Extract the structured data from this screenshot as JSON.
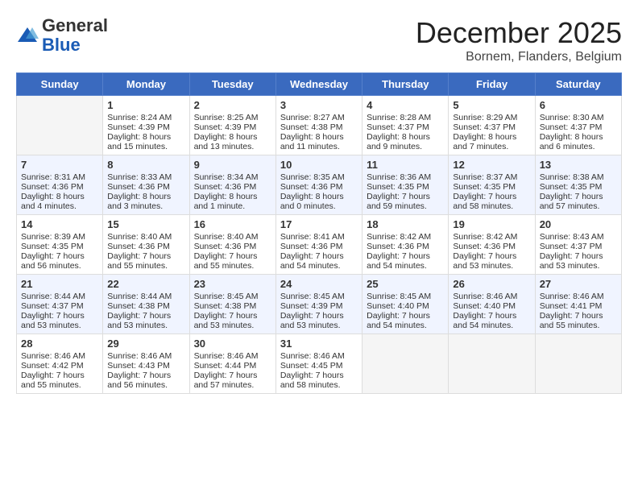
{
  "header": {
    "logo_general": "General",
    "logo_blue": "Blue",
    "month_title": "December 2025",
    "subtitle": "Bornem, Flanders, Belgium"
  },
  "days_of_week": [
    "Sunday",
    "Monday",
    "Tuesday",
    "Wednesday",
    "Thursday",
    "Friday",
    "Saturday"
  ],
  "weeks": [
    [
      {
        "day": "",
        "sunrise": "",
        "sunset": "",
        "daylight": "",
        "empty": true
      },
      {
        "day": "1",
        "sunrise": "Sunrise: 8:24 AM",
        "sunset": "Sunset: 4:39 PM",
        "daylight": "Daylight: 8 hours and 15 minutes."
      },
      {
        "day": "2",
        "sunrise": "Sunrise: 8:25 AM",
        "sunset": "Sunset: 4:39 PM",
        "daylight": "Daylight: 8 hours and 13 minutes."
      },
      {
        "day": "3",
        "sunrise": "Sunrise: 8:27 AM",
        "sunset": "Sunset: 4:38 PM",
        "daylight": "Daylight: 8 hours and 11 minutes."
      },
      {
        "day": "4",
        "sunrise": "Sunrise: 8:28 AM",
        "sunset": "Sunset: 4:37 PM",
        "daylight": "Daylight: 8 hours and 9 minutes."
      },
      {
        "day": "5",
        "sunrise": "Sunrise: 8:29 AM",
        "sunset": "Sunset: 4:37 PM",
        "daylight": "Daylight: 8 hours and 7 minutes."
      },
      {
        "day": "6",
        "sunrise": "Sunrise: 8:30 AM",
        "sunset": "Sunset: 4:37 PM",
        "daylight": "Daylight: 8 hours and 6 minutes."
      }
    ],
    [
      {
        "day": "7",
        "sunrise": "Sunrise: 8:31 AM",
        "sunset": "Sunset: 4:36 PM",
        "daylight": "Daylight: 8 hours and 4 minutes."
      },
      {
        "day": "8",
        "sunrise": "Sunrise: 8:33 AM",
        "sunset": "Sunset: 4:36 PM",
        "daylight": "Daylight: 8 hours and 3 minutes."
      },
      {
        "day": "9",
        "sunrise": "Sunrise: 8:34 AM",
        "sunset": "Sunset: 4:36 PM",
        "daylight": "Daylight: 8 hours and 1 minute."
      },
      {
        "day": "10",
        "sunrise": "Sunrise: 8:35 AM",
        "sunset": "Sunset: 4:36 PM",
        "daylight": "Daylight: 8 hours and 0 minutes."
      },
      {
        "day": "11",
        "sunrise": "Sunrise: 8:36 AM",
        "sunset": "Sunset: 4:35 PM",
        "daylight": "Daylight: 7 hours and 59 minutes."
      },
      {
        "day": "12",
        "sunrise": "Sunrise: 8:37 AM",
        "sunset": "Sunset: 4:35 PM",
        "daylight": "Daylight: 7 hours and 58 minutes."
      },
      {
        "day": "13",
        "sunrise": "Sunrise: 8:38 AM",
        "sunset": "Sunset: 4:35 PM",
        "daylight": "Daylight: 7 hours and 57 minutes."
      }
    ],
    [
      {
        "day": "14",
        "sunrise": "Sunrise: 8:39 AM",
        "sunset": "Sunset: 4:35 PM",
        "daylight": "Daylight: 7 hours and 56 minutes."
      },
      {
        "day": "15",
        "sunrise": "Sunrise: 8:40 AM",
        "sunset": "Sunset: 4:36 PM",
        "daylight": "Daylight: 7 hours and 55 minutes."
      },
      {
        "day": "16",
        "sunrise": "Sunrise: 8:40 AM",
        "sunset": "Sunset: 4:36 PM",
        "daylight": "Daylight: 7 hours and 55 minutes."
      },
      {
        "day": "17",
        "sunrise": "Sunrise: 8:41 AM",
        "sunset": "Sunset: 4:36 PM",
        "daylight": "Daylight: 7 hours and 54 minutes."
      },
      {
        "day": "18",
        "sunrise": "Sunrise: 8:42 AM",
        "sunset": "Sunset: 4:36 PM",
        "daylight": "Daylight: 7 hours and 54 minutes."
      },
      {
        "day": "19",
        "sunrise": "Sunrise: 8:42 AM",
        "sunset": "Sunset: 4:36 PM",
        "daylight": "Daylight: 7 hours and 53 minutes."
      },
      {
        "day": "20",
        "sunrise": "Sunrise: 8:43 AM",
        "sunset": "Sunset: 4:37 PM",
        "daylight": "Daylight: 7 hours and 53 minutes."
      }
    ],
    [
      {
        "day": "21",
        "sunrise": "Sunrise: 8:44 AM",
        "sunset": "Sunset: 4:37 PM",
        "daylight": "Daylight: 7 hours and 53 minutes."
      },
      {
        "day": "22",
        "sunrise": "Sunrise: 8:44 AM",
        "sunset": "Sunset: 4:38 PM",
        "daylight": "Daylight: 7 hours and 53 minutes."
      },
      {
        "day": "23",
        "sunrise": "Sunrise: 8:45 AM",
        "sunset": "Sunset: 4:38 PM",
        "daylight": "Daylight: 7 hours and 53 minutes."
      },
      {
        "day": "24",
        "sunrise": "Sunrise: 8:45 AM",
        "sunset": "Sunset: 4:39 PM",
        "daylight": "Daylight: 7 hours and 53 minutes."
      },
      {
        "day": "25",
        "sunrise": "Sunrise: 8:45 AM",
        "sunset": "Sunset: 4:40 PM",
        "daylight": "Daylight: 7 hours and 54 minutes."
      },
      {
        "day": "26",
        "sunrise": "Sunrise: 8:46 AM",
        "sunset": "Sunset: 4:40 PM",
        "daylight": "Daylight: 7 hours and 54 minutes."
      },
      {
        "day": "27",
        "sunrise": "Sunrise: 8:46 AM",
        "sunset": "Sunset: 4:41 PM",
        "daylight": "Daylight: 7 hours and 55 minutes."
      }
    ],
    [
      {
        "day": "28",
        "sunrise": "Sunrise: 8:46 AM",
        "sunset": "Sunset: 4:42 PM",
        "daylight": "Daylight: 7 hours and 55 minutes."
      },
      {
        "day": "29",
        "sunrise": "Sunrise: 8:46 AM",
        "sunset": "Sunset: 4:43 PM",
        "daylight": "Daylight: 7 hours and 56 minutes."
      },
      {
        "day": "30",
        "sunrise": "Sunrise: 8:46 AM",
        "sunset": "Sunset: 4:44 PM",
        "daylight": "Daylight: 7 hours and 57 minutes."
      },
      {
        "day": "31",
        "sunrise": "Sunrise: 8:46 AM",
        "sunset": "Sunset: 4:45 PM",
        "daylight": "Daylight: 7 hours and 58 minutes."
      },
      {
        "day": "",
        "sunrise": "",
        "sunset": "",
        "daylight": "",
        "empty": true
      },
      {
        "day": "",
        "sunrise": "",
        "sunset": "",
        "daylight": "",
        "empty": true
      },
      {
        "day": "",
        "sunrise": "",
        "sunset": "",
        "daylight": "",
        "empty": true
      }
    ]
  ]
}
